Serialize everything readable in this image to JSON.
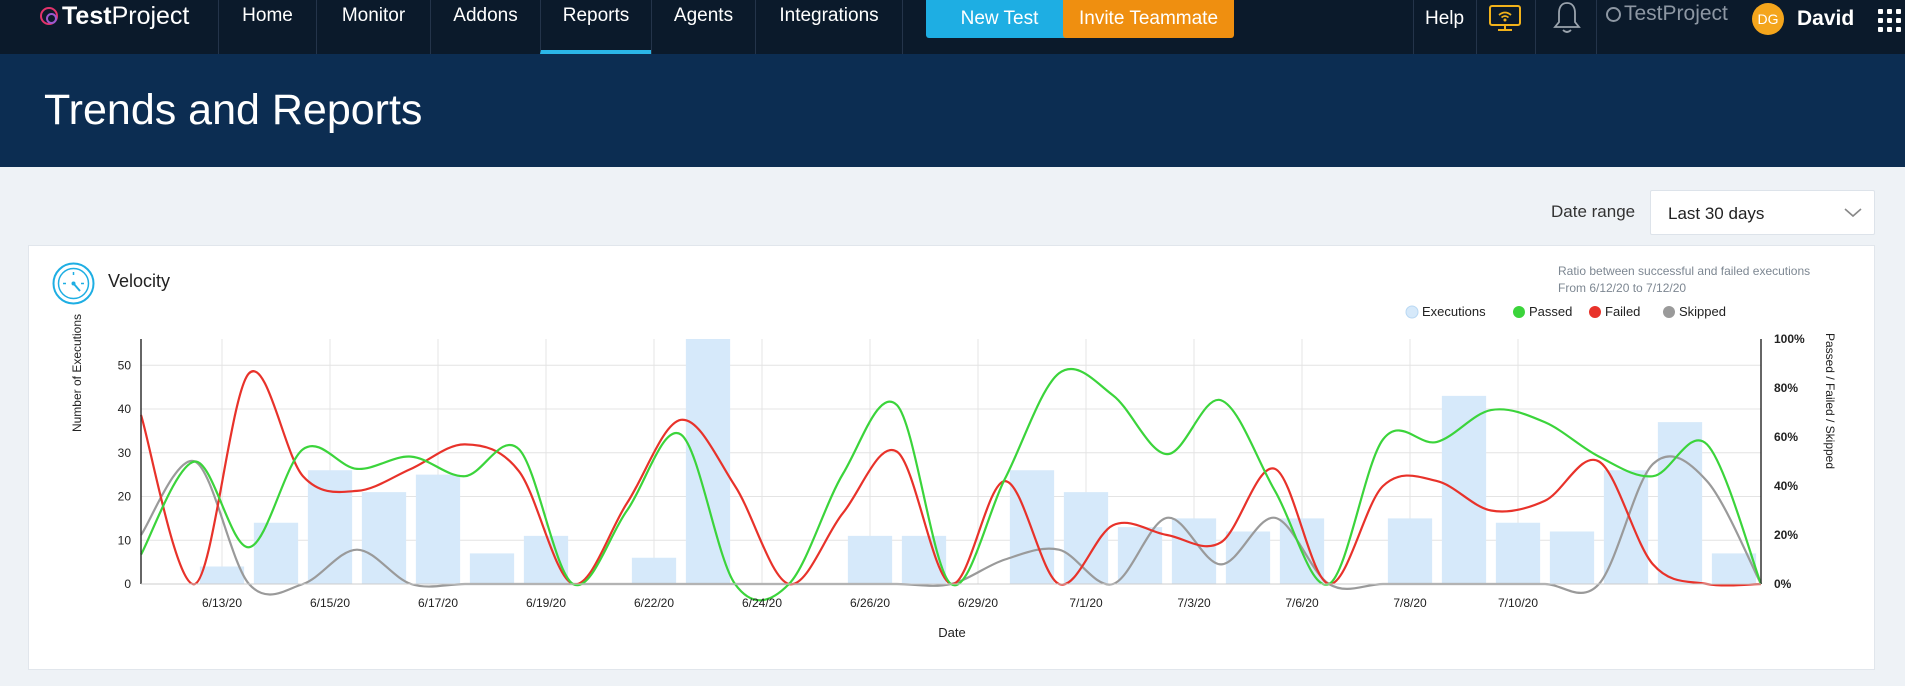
{
  "nav": {
    "logo": "TestProject",
    "logo_bold": "Test",
    "logo_rest": "Project",
    "items": [
      {
        "label": "Home"
      },
      {
        "label": "Monitor"
      },
      {
        "label": "Addons"
      },
      {
        "label": "Reports",
        "active": true
      },
      {
        "label": "Agents"
      },
      {
        "label": "Integrations"
      }
    ],
    "new_test": "New Test",
    "invite": "Invite Teammate",
    "help": "Help",
    "brand_repeat": "TestProject",
    "avatar_initials": "DG",
    "user_name": "David"
  },
  "page": {
    "title": "Trends and Reports",
    "date_range_label": "Date range",
    "date_range_value": "Last 30 days"
  },
  "card": {
    "title": "Velocity",
    "ratio_line1": "Ratio between successful and failed executions",
    "ratio_line2": "From 6/12/20 to 7/12/20"
  },
  "colors": {
    "executions": "#d6e9fa",
    "passed": "#3bd43b",
    "failed": "#e8322a",
    "skipped": "#9a9a9a",
    "accent": "#1eaee3",
    "invite": "#ef8f10"
  },
  "chart_data": {
    "type": "bar",
    "xlabel": "Date",
    "ylabel": "Number of Executions",
    "y2label": "Passed / Failed / Skipped",
    "ylim": [
      0,
      56
    ],
    "y2lim": [
      0,
      100
    ],
    "yticks": [
      0,
      10,
      20,
      30,
      40,
      50
    ],
    "y2ticks": [
      "0%",
      "20%",
      "40%",
      "60%",
      "80%",
      "100%"
    ],
    "x_tick_labels": [
      "6/13/20",
      "6/15/20",
      "6/17/20",
      "6/19/20",
      "6/22/20",
      "6/24/20",
      "6/26/20",
      "6/29/20",
      "7/1/20",
      "7/3/20",
      "7/6/20",
      "7/8/20",
      "7/10/20"
    ],
    "x_tick_index": [
      1,
      3,
      5,
      7,
      9,
      11,
      13,
      15,
      17,
      19,
      21,
      23,
      25
    ],
    "legend": [
      "Executions",
      "Passed",
      "Failed",
      "Skipped"
    ],
    "legend_position": "top-right",
    "grid": true,
    "series": [
      {
        "name": "Executions",
        "kind": "bar",
        "values": [
          0,
          4,
          14,
          26,
          21,
          25,
          7,
          11,
          0,
          6,
          56,
          0,
          0,
          11,
          11,
          0,
          26,
          21,
          13,
          15,
          12,
          15,
          0,
          15,
          43,
          14,
          12,
          26,
          37,
          7
        ]
      },
      {
        "name": "Passed",
        "kind": "line",
        "values": [
          12,
          50,
          15,
          55,
          47,
          52,
          44,
          55,
          0,
          30,
          61,
          0,
          0,
          45,
          73,
          0,
          43,
          86,
          77,
          53,
          75,
          38,
          0,
          59,
          58,
          71,
          66,
          52,
          44,
          57,
          0
        ]
      },
      {
        "name": "Failed",
        "kind": "line",
        "values": [
          69,
          0,
          86,
          44,
          38,
          47,
          57,
          46,
          0,
          33,
          67,
          40,
          0,
          29,
          54,
          0,
          42,
          0,
          24,
          20,
          17,
          47,
          0,
          40,
          42,
          30,
          34,
          50,
          8,
          0,
          0
        ]
      },
      {
        "name": "Skipped",
        "kind": "line",
        "values": [
          20,
          50,
          0,
          0,
          14,
          0,
          0,
          0,
          0,
          0,
          0,
          0,
          0,
          0,
          0,
          0,
          10,
          14,
          0,
          27,
          8,
          27,
          0,
          0,
          0,
          0,
          0,
          0,
          49,
          42,
          0
        ]
      }
    ]
  }
}
